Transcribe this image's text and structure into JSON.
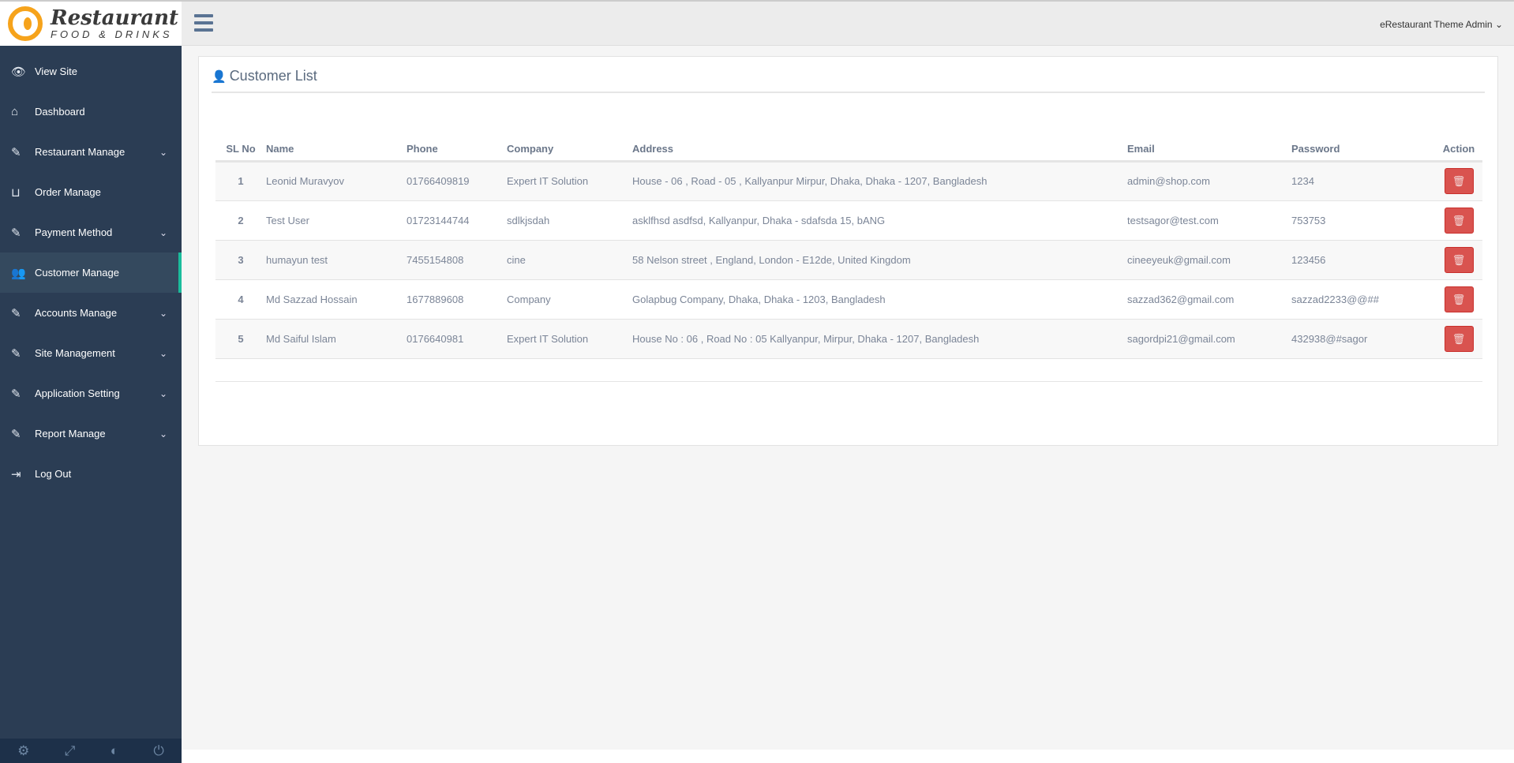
{
  "brand": {
    "name": "Restaurant",
    "tagline": "FOOD & DRINKS"
  },
  "header": {
    "user": "eRestaurant Theme Admin"
  },
  "sidebar": {
    "items": [
      {
        "label": "View Site",
        "icon": "eye-icon",
        "glyph": "👁",
        "chevron": false
      },
      {
        "label": "Dashboard",
        "icon": "home-icon",
        "glyph": "⌂",
        "chevron": false
      },
      {
        "label": "Restaurant Manage",
        "icon": "edit-icon",
        "glyph": "✎",
        "chevron": true
      },
      {
        "label": "Order Manage",
        "icon": "basket-icon",
        "glyph": "⊔",
        "chevron": false
      },
      {
        "label": "Payment Method",
        "icon": "edit-icon",
        "glyph": "✎",
        "chevron": true
      },
      {
        "label": "Customer Manage",
        "icon": "users-icon",
        "glyph": "👥",
        "chevron": false,
        "active": true
      },
      {
        "label": "Accounts Manage",
        "icon": "edit-icon",
        "glyph": "✎",
        "chevron": true
      },
      {
        "label": "Site Management",
        "icon": "edit-icon",
        "glyph": "✎",
        "chevron": true
      },
      {
        "label": "Application Setting",
        "icon": "edit-icon",
        "glyph": "✎",
        "chevron": true
      },
      {
        "label": "Report Manage",
        "icon": "edit-icon",
        "glyph": "✎",
        "chevron": true
      },
      {
        "label": "Log Out",
        "icon": "sign-out-icon",
        "glyph": "⇥",
        "chevron": false
      }
    ]
  },
  "panel": {
    "title": "Customer List"
  },
  "table": {
    "headers": [
      "SL No",
      "Name",
      "Phone",
      "Company",
      "Address",
      "Email",
      "Password",
      "Action"
    ],
    "rows": [
      [
        "1",
        "Leonid Muravyov",
        "01766409819",
        "Expert IT Solution",
        "House - 06 , Road - 05 , Kallyanpur Mirpur, Dhaka, Dhaka - 1207, Bangladesh",
        "admin@shop.com",
        "1234"
      ],
      [
        "2",
        "Test User",
        "01723144744",
        "sdlkjsdah",
        "asklfhsd asdfsd, Kallyanpur, Dhaka - sdafsda 15, bANG",
        "testsagor@test.com",
        "753753"
      ],
      [
        "3",
        "humayun test",
        "7455154808",
        "cine",
        "58 Nelson street , England, London - E12de, United Kingdom",
        "cineeyeuk@gmail.com",
        "123456"
      ],
      [
        "4",
        "Md Sazzad Hossain",
        "1677889608",
        "Company",
        "Golapbug Company, Dhaka, Dhaka - 1203, Bangladesh",
        "sazzad362@gmail.com",
        "sazzad2233@@##"
      ],
      [
        "5",
        "Md Saiful Islam",
        "0176640981",
        "Expert IT Solution",
        "House No : 06 , Road No : 05 Kallyanpur, Mirpur, Dhaka - 1207, Bangladesh",
        "sagordpi21@gmail.com",
        "432938@#sagor"
      ]
    ]
  },
  "colors": {
    "sidebar": "#2b3d54",
    "accent": "#1abc9c",
    "danger": "#d9534f"
  }
}
